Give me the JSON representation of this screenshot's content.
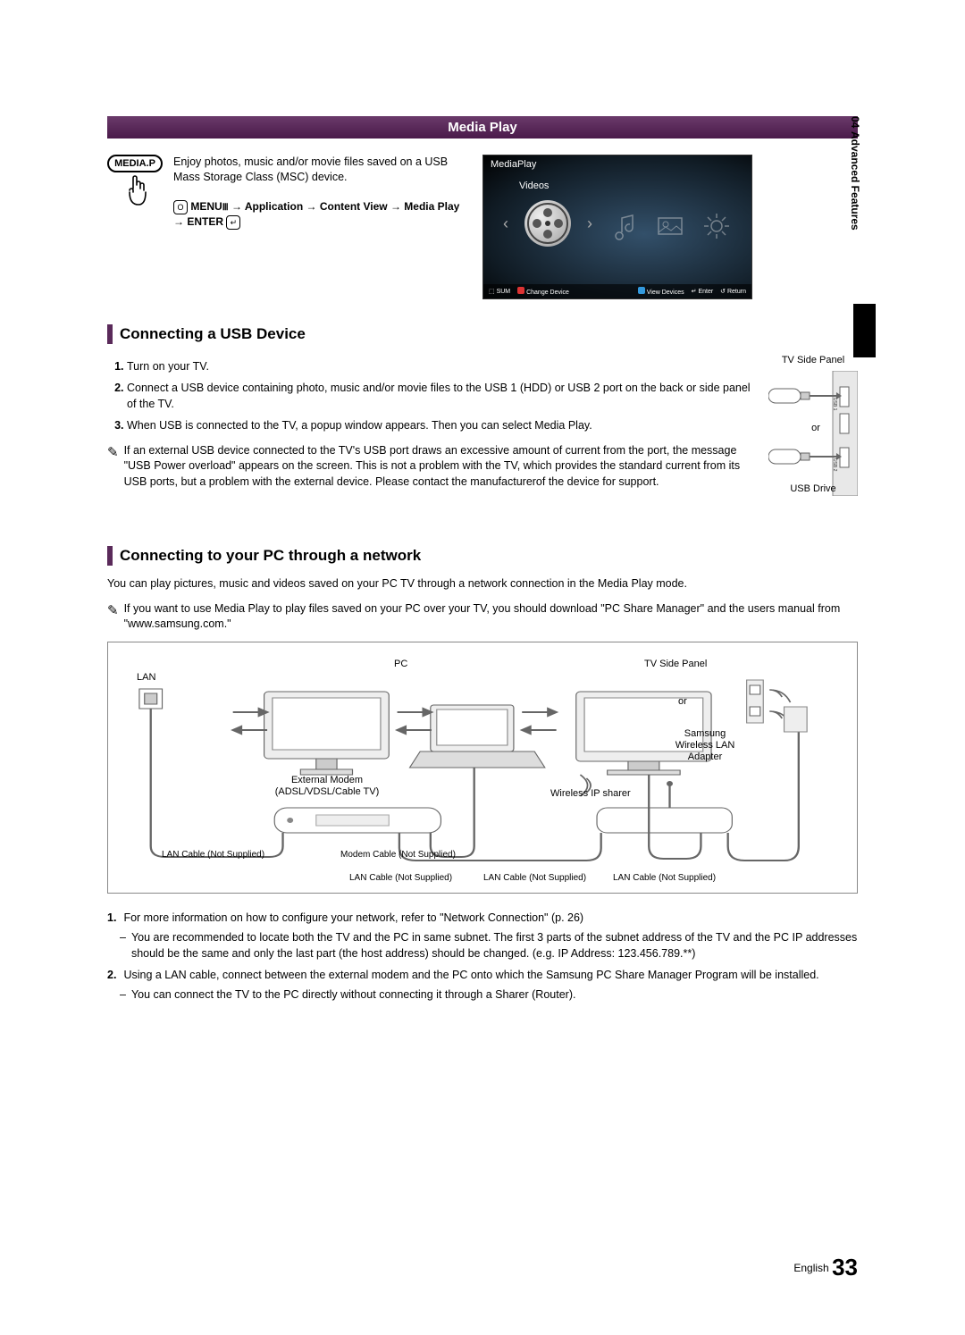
{
  "side_tab": {
    "number": "04",
    "label": "Advanced Features"
  },
  "header": {
    "title": "Media Play"
  },
  "intro": {
    "remote_button": "MEDIA.P",
    "text": "Enjoy photos, music and/or movie files saved on a USB Mass Storage Class (MSC) device.",
    "nav": {
      "menu": "MENU",
      "path1": " → Application → Content View → Media Play → ENTER"
    }
  },
  "mediaplay_screen": {
    "title": "MediaPlay",
    "category": "Videos",
    "bottom": {
      "sum": "SUM",
      "change": "Change Device",
      "view": "View Devices",
      "enter": "Enter",
      "return": "Return"
    }
  },
  "section_usb": {
    "title": "Connecting a USB Device",
    "steps": [
      "Turn on your TV.",
      "Connect a USB device containing photo, music and/or movie files to the USB 1 (HDD) or USB 2 port on the back or side panel of the TV.",
      "When USB is connected to the TV, a popup window appears. Then you can select Media Play."
    ],
    "note": "If an external USB device connected to the TV's USB port draws an excessive amount of current from the port, the message \"USB Power overload\" appears on the screen. This is not a problem with the TV, which provides the standard current from its USB ports, but a problem with the external device. Please contact the manufacturerof the device for support.",
    "side_panel": {
      "label": "TV Side Panel",
      "or": "or",
      "usb_drive": "USB Drive"
    }
  },
  "section_pc": {
    "title": "Connecting to your PC through a network",
    "intro": "You can play pictures, music and videos saved on your PC TV through a network connection in the Media Play mode.",
    "note": "If you want to use Media Play to play files saved on your PC over your TV, you should download \"PC Share Manager\" and the users manual from \"www.samsung.com.\"",
    "diagram": {
      "lan": "LAN",
      "pc": "PC",
      "tv_side": "TV Side Panel",
      "or": "or",
      "samsung_adapter": "Samsung Wireless LAN Adapter",
      "external_modem": "External Modem",
      "external_modem_sub": "(ADSL/VDSL/Cable TV)",
      "wireless_sharer": "Wireless IP sharer",
      "lan_cable": "LAN Cable (Not Supplied)",
      "modem_cable": "Modem Cable (Not Supplied)"
    },
    "steps": [
      {
        "num": "1.",
        "text": "For more information on how to configure your network, refer to \"Network Connection\" (p. 26)",
        "sub": [
          "You are recommended to locate both the TV and the PC in same subnet. The first 3 parts of the subnet address of the TV and the PC IP addresses should be the same and only the last part (the host address) should be changed. (e.g. IP Address: 123.456.789.**)"
        ]
      },
      {
        "num": "2.",
        "text": "Using a LAN cable, connect between the external modem and the PC onto which the Samsung PC Share Manager Program will be installed.",
        "sub": [
          "You can connect the TV to the PC directly without connecting it through a Sharer (Router)."
        ]
      }
    ]
  },
  "footer": {
    "lang": "English",
    "page": "33"
  }
}
